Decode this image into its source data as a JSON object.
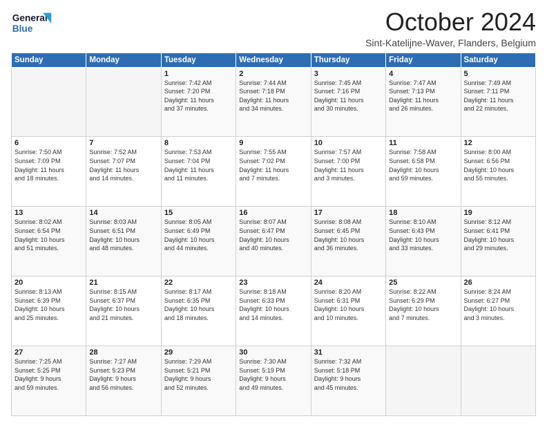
{
  "header": {
    "logo_line1": "General",
    "logo_line2": "Blue",
    "month": "October 2024",
    "location": "Sint-Katelijne-Waver, Flanders, Belgium"
  },
  "weekdays": [
    "Sunday",
    "Monday",
    "Tuesday",
    "Wednesday",
    "Thursday",
    "Friday",
    "Saturday"
  ],
  "weeks": [
    [
      {
        "day": "",
        "info": ""
      },
      {
        "day": "",
        "info": ""
      },
      {
        "day": "1",
        "info": "Sunrise: 7:42 AM\nSunset: 7:20 PM\nDaylight: 11 hours\nand 37 minutes."
      },
      {
        "day": "2",
        "info": "Sunrise: 7:44 AM\nSunset: 7:18 PM\nDaylight: 11 hours\nand 34 minutes."
      },
      {
        "day": "3",
        "info": "Sunrise: 7:45 AM\nSunset: 7:16 PM\nDaylight: 11 hours\nand 30 minutes."
      },
      {
        "day": "4",
        "info": "Sunrise: 7:47 AM\nSunset: 7:13 PM\nDaylight: 11 hours\nand 26 minutes."
      },
      {
        "day": "5",
        "info": "Sunrise: 7:49 AM\nSunset: 7:11 PM\nDaylight: 11 hours\nand 22 minutes."
      }
    ],
    [
      {
        "day": "6",
        "info": "Sunrise: 7:50 AM\nSunset: 7:09 PM\nDaylight: 11 hours\nand 18 minutes."
      },
      {
        "day": "7",
        "info": "Sunrise: 7:52 AM\nSunset: 7:07 PM\nDaylight: 11 hours\nand 14 minutes."
      },
      {
        "day": "8",
        "info": "Sunrise: 7:53 AM\nSunset: 7:04 PM\nDaylight: 11 hours\nand 11 minutes."
      },
      {
        "day": "9",
        "info": "Sunrise: 7:55 AM\nSunset: 7:02 PM\nDaylight: 11 hours\nand 7 minutes."
      },
      {
        "day": "10",
        "info": "Sunrise: 7:57 AM\nSunset: 7:00 PM\nDaylight: 11 hours\nand 3 minutes."
      },
      {
        "day": "11",
        "info": "Sunrise: 7:58 AM\nSunset: 6:58 PM\nDaylight: 10 hours\nand 59 minutes."
      },
      {
        "day": "12",
        "info": "Sunrise: 8:00 AM\nSunset: 6:56 PM\nDaylight: 10 hours\nand 55 minutes."
      }
    ],
    [
      {
        "day": "13",
        "info": "Sunrise: 8:02 AM\nSunset: 6:54 PM\nDaylight: 10 hours\nand 51 minutes."
      },
      {
        "day": "14",
        "info": "Sunrise: 8:03 AM\nSunset: 6:51 PM\nDaylight: 10 hours\nand 48 minutes."
      },
      {
        "day": "15",
        "info": "Sunrise: 8:05 AM\nSunset: 6:49 PM\nDaylight: 10 hours\nand 44 minutes."
      },
      {
        "day": "16",
        "info": "Sunrise: 8:07 AM\nSunset: 6:47 PM\nDaylight: 10 hours\nand 40 minutes."
      },
      {
        "day": "17",
        "info": "Sunrise: 8:08 AM\nSunset: 6:45 PM\nDaylight: 10 hours\nand 36 minutes."
      },
      {
        "day": "18",
        "info": "Sunrise: 8:10 AM\nSunset: 6:43 PM\nDaylight: 10 hours\nand 33 minutes."
      },
      {
        "day": "19",
        "info": "Sunrise: 8:12 AM\nSunset: 6:41 PM\nDaylight: 10 hours\nand 29 minutes."
      }
    ],
    [
      {
        "day": "20",
        "info": "Sunrise: 8:13 AM\nSunset: 6:39 PM\nDaylight: 10 hours\nand 25 minutes."
      },
      {
        "day": "21",
        "info": "Sunrise: 8:15 AM\nSunset: 6:37 PM\nDaylight: 10 hours\nand 21 minutes."
      },
      {
        "day": "22",
        "info": "Sunrise: 8:17 AM\nSunset: 6:35 PM\nDaylight: 10 hours\nand 18 minutes."
      },
      {
        "day": "23",
        "info": "Sunrise: 8:18 AM\nSunset: 6:33 PM\nDaylight: 10 hours\nand 14 minutes."
      },
      {
        "day": "24",
        "info": "Sunrise: 8:20 AM\nSunset: 6:31 PM\nDaylight: 10 hours\nand 10 minutes."
      },
      {
        "day": "25",
        "info": "Sunrise: 8:22 AM\nSunset: 6:29 PM\nDaylight: 10 hours\nand 7 minutes."
      },
      {
        "day": "26",
        "info": "Sunrise: 8:24 AM\nSunset: 6:27 PM\nDaylight: 10 hours\nand 3 minutes."
      }
    ],
    [
      {
        "day": "27",
        "info": "Sunrise: 7:25 AM\nSunset: 5:25 PM\nDaylight: 9 hours\nand 59 minutes."
      },
      {
        "day": "28",
        "info": "Sunrise: 7:27 AM\nSunset: 5:23 PM\nDaylight: 9 hours\nand 56 minutes."
      },
      {
        "day": "29",
        "info": "Sunrise: 7:29 AM\nSunset: 5:21 PM\nDaylight: 9 hours\nand 52 minutes."
      },
      {
        "day": "30",
        "info": "Sunrise: 7:30 AM\nSunset: 5:19 PM\nDaylight: 9 hours\nand 49 minutes."
      },
      {
        "day": "31",
        "info": "Sunrise: 7:32 AM\nSunset: 5:18 PM\nDaylight: 9 hours\nand 45 minutes."
      },
      {
        "day": "",
        "info": ""
      },
      {
        "day": "",
        "info": ""
      }
    ]
  ]
}
